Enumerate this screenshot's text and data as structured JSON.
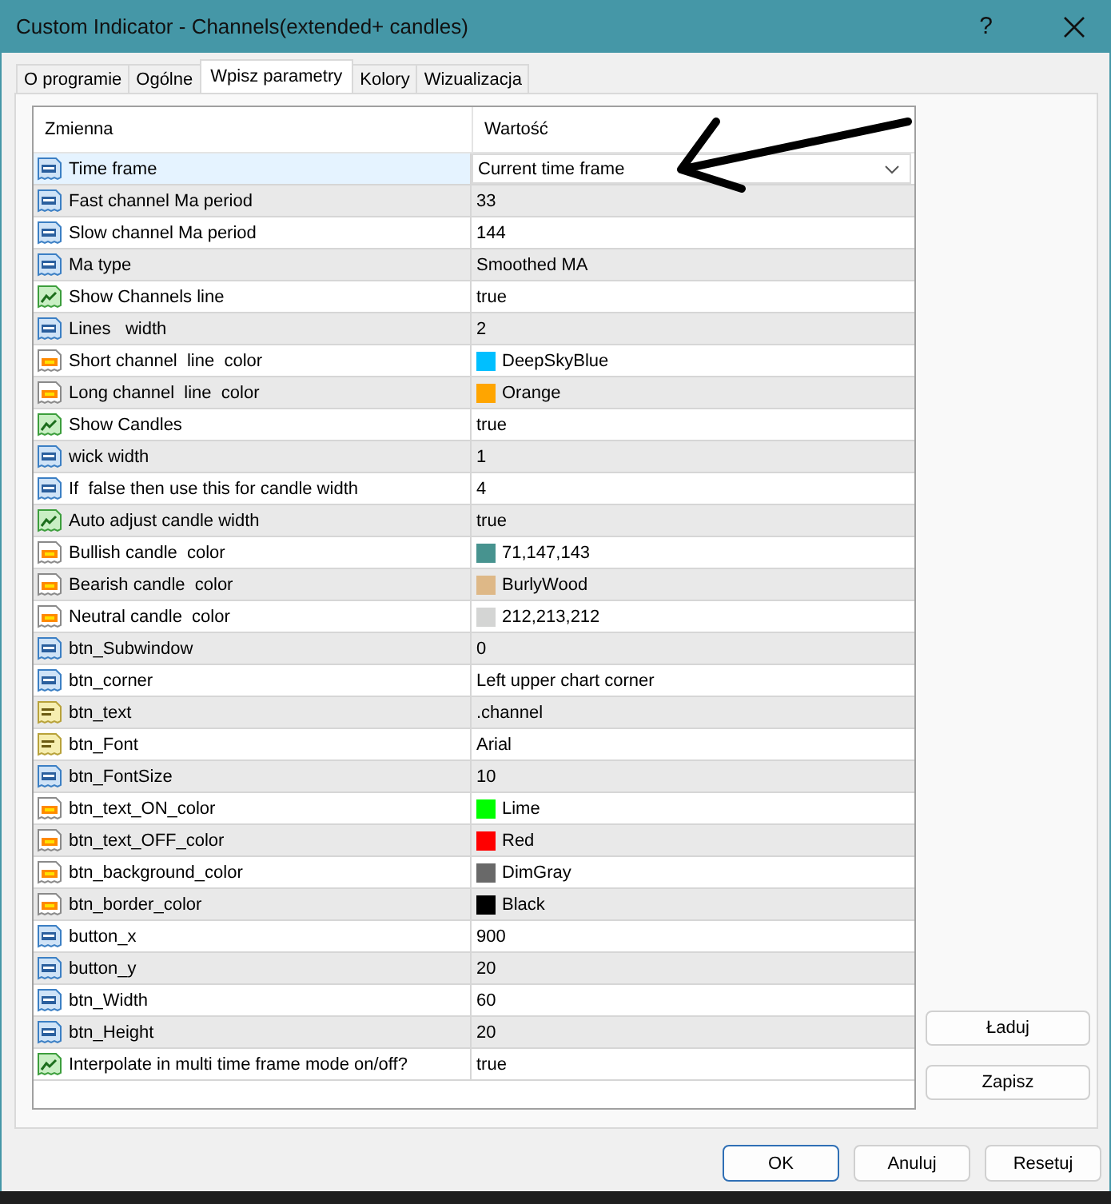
{
  "window": {
    "title": "Custom Indicator - Channels(extended+ candles)",
    "help": "?"
  },
  "tabs": [
    {
      "label": "O programie",
      "selected": false
    },
    {
      "label": "Ogólne",
      "selected": false
    },
    {
      "label": "Wpisz parametry",
      "selected": true
    },
    {
      "label": "Kolory",
      "selected": false
    },
    {
      "label": "Wizualizacja",
      "selected": false
    }
  ],
  "table": {
    "columns": [
      "Zmienna",
      "Wartość"
    ],
    "rows": [
      {
        "kind": "number",
        "name": "Time frame",
        "value": "Current time frame",
        "selected": true
      },
      {
        "kind": "number",
        "name": "Fast channel Ma period",
        "value": "33",
        "selected": false
      },
      {
        "kind": "number",
        "name": "Slow channel Ma period",
        "value": "144",
        "selected": false
      },
      {
        "kind": "number",
        "name": "Ma type",
        "value": "Smoothed MA",
        "selected": false
      },
      {
        "kind": "bool",
        "name": "Show Channels line",
        "value": "true",
        "selected": false
      },
      {
        "kind": "number",
        "name": "Lines   width",
        "value": "2",
        "selected": false
      },
      {
        "kind": "color",
        "name": "Short channel  line  color",
        "value": "DeepSkyBlue",
        "color": "#00bfff",
        "selected": false
      },
      {
        "kind": "color",
        "name": "Long channel  line  color",
        "value": "Orange",
        "color": "#ffa500",
        "selected": false
      },
      {
        "kind": "bool",
        "name": "Show Candles",
        "value": "true",
        "selected": false
      },
      {
        "kind": "number",
        "name": "wick width",
        "value": "1",
        "selected": false
      },
      {
        "kind": "number",
        "name": "If  false then use this for candle width",
        "value": "4",
        "selected": false
      },
      {
        "kind": "bool",
        "name": "Auto adjust candle width",
        "value": "true",
        "selected": false
      },
      {
        "kind": "color",
        "name": "Bullish candle  color",
        "value": "71,147,143",
        "color": "#47938f",
        "selected": false
      },
      {
        "kind": "color",
        "name": "Bearish candle  color",
        "value": "BurlyWood",
        "color": "#deb887",
        "selected": false
      },
      {
        "kind": "color",
        "name": "Neutral candle  color",
        "value": "212,213,212",
        "color": "#d4d5d4",
        "selected": false
      },
      {
        "kind": "number",
        "name": "btn_Subwindow",
        "value": "0",
        "selected": false
      },
      {
        "kind": "number",
        "name": "btn_corner",
        "value": "Left upper chart corner",
        "selected": false
      },
      {
        "kind": "text",
        "name": "btn_text",
        "value": ".channel",
        "selected": false
      },
      {
        "kind": "text",
        "name": "btn_Font",
        "value": "Arial",
        "selected": false
      },
      {
        "kind": "number",
        "name": "btn_FontSize",
        "value": "10",
        "selected": false
      },
      {
        "kind": "color",
        "name": "btn_text_ON_color",
        "value": "Lime",
        "color": "#00ff00",
        "selected": false
      },
      {
        "kind": "color",
        "name": "btn_text_OFF_color",
        "value": "Red",
        "color": "#ff0000",
        "selected": false
      },
      {
        "kind": "color",
        "name": "btn_background_color",
        "value": "DimGray",
        "color": "#696969",
        "selected": false
      },
      {
        "kind": "color",
        "name": "btn_border_color",
        "value": "Black",
        "color": "#000000",
        "selected": false
      },
      {
        "kind": "number",
        "name": "button_x",
        "value": "900",
        "selected": false
      },
      {
        "kind": "number",
        "name": "button_y",
        "value": "20",
        "selected": false
      },
      {
        "kind": "number",
        "name": "btn_Width",
        "value": "60",
        "selected": false
      },
      {
        "kind": "number",
        "name": "btn_Height",
        "value": "20",
        "selected": false
      },
      {
        "kind": "bool",
        "name": "Interpolate in multi time frame mode on/off?",
        "value": "true",
        "selected": false
      }
    ]
  },
  "side_buttons": [
    "Ładuj",
    "Zapisz"
  ],
  "buttons": [
    {
      "label": "OK",
      "default": true
    },
    {
      "label": "Anuluj",
      "default": false
    },
    {
      "label": "Resetuj",
      "default": false
    }
  ]
}
